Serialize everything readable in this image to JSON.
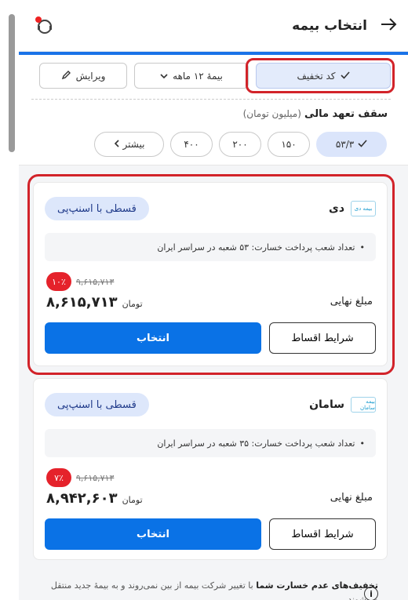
{
  "header": {
    "title": "انتخاب بیمه",
    "back_icon": "arrow-right-icon",
    "support_icon": "support-agent-icon"
  },
  "filters": {
    "discount_label": "کد تخفیف",
    "insurance_label": "بیمهٔ ۱۲ ماهه",
    "edit_label": "ویرایش"
  },
  "coverage": {
    "title": "سقف تعهد مالی",
    "unit": "(میلیون تومان)",
    "options": [
      "۵۳/۳",
      "۱۵۰",
      "۲۰۰",
      "۴۰۰"
    ],
    "selected": "۵۳/۳",
    "more_label": "بیشتر"
  },
  "offers": [
    {
      "insurer": "دی",
      "logo_text": "بیمه دی",
      "installment_badge": "قسطی با اسنپ‌پی",
      "info": "تعداد شعب پرداخت خسارت: ۵۳ شعبه در سراسر ایران",
      "discount": "۱۰٪",
      "old_price": "۹,۶۱۵,۷۱۳",
      "final_label": "مبلغ نهایی",
      "price": "۸,۶۱۵,۷۱۳",
      "currency": "تومان",
      "terms_button": "شرایط اقساط",
      "select_button": "انتخاب"
    },
    {
      "insurer": "سامان",
      "logo_text": "بیمه سامان",
      "installment_badge": "قسطی با اسنپ‌پی",
      "info": "تعداد شعب پرداخت خسارت: ۳۵ شعبه در سراسر ایران",
      "discount": "۷٪",
      "old_price": "۹,۶۱۵,۷۱۳",
      "final_label": "مبلغ نهایی",
      "price": "۸,۹۴۲,۶۰۳",
      "currency": "تومان",
      "terms_button": "شرایط اقساط",
      "select_button": "انتخاب"
    }
  ],
  "footer": {
    "bold": "تخفیف‌های عدم خسارت شما",
    "text": " با تغییر شرکت بیمه از بین نمی‌روند و به بیمهٔ جدید منتقل می‌شوند."
  },
  "colors": {
    "primary": "#0a72e6",
    "discount_red": "#e5222b",
    "highlight": "#d2232a",
    "chip_selected": "#dbe5fb"
  }
}
